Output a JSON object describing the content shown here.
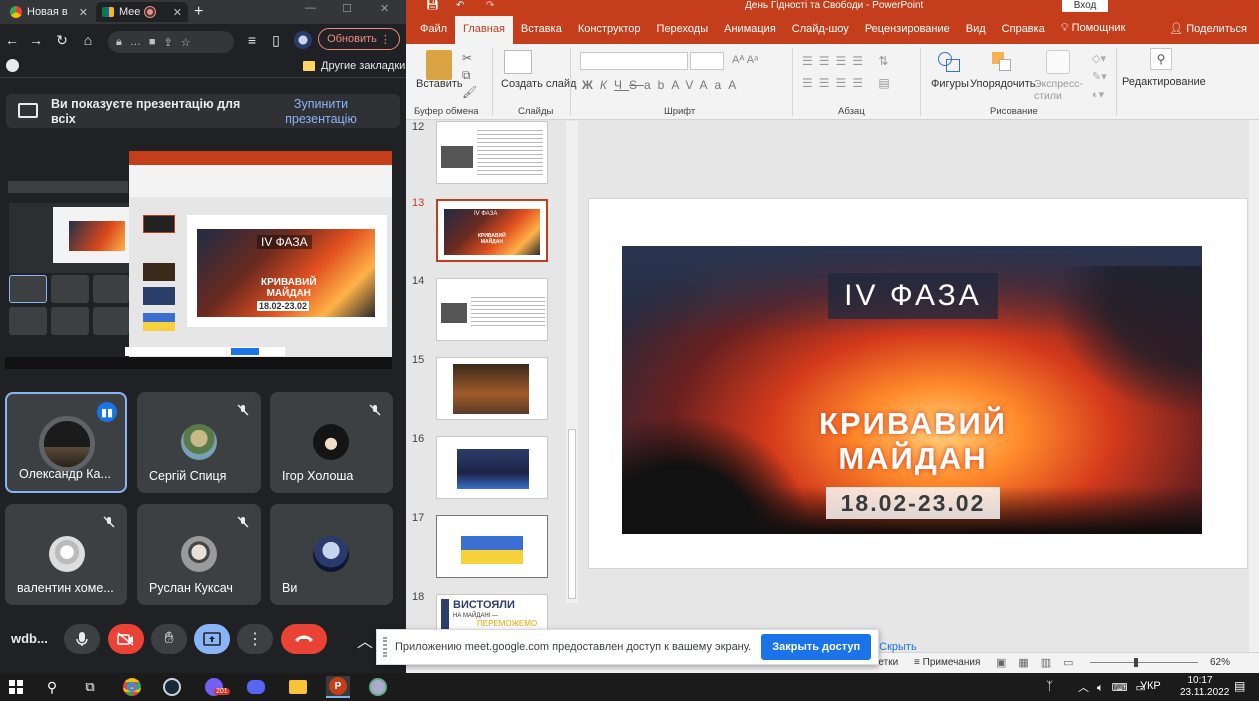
{
  "browser": {
    "tabs": [
      {
        "title": "Новая в",
        "icon": "chrome-icon"
      },
      {
        "title": "Mee",
        "icon": "meet-icon"
      }
    ],
    "update_button": "Обновить",
    "bookmarks_folder": "Другие закладки"
  },
  "meet": {
    "presenting_text": "Ви показуєте презентацію для всіх",
    "stop_presenting": "Зупинити презентацію",
    "participants": [
      {
        "name": "Олександр Ка...",
        "speaking": true
      },
      {
        "name": "Сергій Спиця",
        "muted": true
      },
      {
        "name": "Ігор Холоша",
        "muted": true
      },
      {
        "name": "валентин хоме...",
        "muted": true
      },
      {
        "name": "Руслан Куксач",
        "muted": true
      },
      {
        "name": "Ви",
        "muted": false
      }
    ],
    "meeting_code": "wdb...",
    "colors": {
      "end_call": "#ea4335",
      "present": "#8ab4f8",
      "cam_off": "#ea4335"
    }
  },
  "powerpoint": {
    "title": "День Гідності та Свободи - PowerPoint",
    "signin": "Вход",
    "share": "Поделиться",
    "ribbon_tabs": [
      "Файл",
      "Главная",
      "Вставка",
      "Конструктор",
      "Переходы",
      "Анимация",
      "Слайд-шоу",
      "Рецензирование",
      "Вид",
      "Справка",
      "Помощник"
    ],
    "active_tab": "Главная",
    "ribbon": {
      "paste": "Вставить",
      "new_slide": "Создать слайд",
      "groups": {
        "clipboard": "Буфер обмена",
        "slides": "Слайды",
        "font": "Шрифт",
        "paragraph": "Абзац",
        "drawing": "Рисование"
      },
      "shapes": "Фигуры",
      "arrange": "Упорядочить",
      "quick_styles": "Экспресс-стили",
      "editing": "Редактирование",
      "font_buttons": [
        "Ж",
        "К",
        "Ч",
        "S",
        "ab",
        "AV",
        "Aa",
        "A"
      ]
    },
    "slide_numbers": [
      "12",
      "13",
      "14",
      "15",
      "16",
      "17",
      "18"
    ],
    "selected_slide": "13",
    "slide": {
      "phase": "IV ФАЗА",
      "line1": "КРИВАВИЙ",
      "line2": "МАЙДАН",
      "dates": "18.02-23.02"
    },
    "thumb18_text1": "ВИСТОЯЛИ",
    "thumb18_text2": "НА МАЙДАНІ —",
    "thumb18_text3": "ПЕРЕМОЖЕМО",
    "status": {
      "notes_short": "аметки",
      "notes": "Примечания",
      "zoom": "62%"
    }
  },
  "share_toast": {
    "text": "Приложению meet.google.com предоставлен доступ к вашему экрану.",
    "stop": "Закрыть доступ",
    "hide": "Скрыть"
  },
  "taskbar": {
    "lang": "УКР",
    "time": "10:17",
    "date": "23.11.2022",
    "badge": "201"
  }
}
